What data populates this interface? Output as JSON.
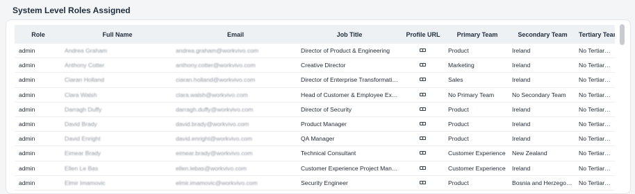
{
  "page": {
    "title": "System Level Roles Assigned"
  },
  "table": {
    "headers": [
      "Role",
      "Full Name",
      "Email",
      "Job Title",
      "Profile URL",
      "Primary Team",
      "Secondary Team",
      "Tertiary Team"
    ],
    "rows": [
      [
        "admin",
        "Andrea Graham",
        "andrea.graham@workvivo.com",
        "Director of Product & Engineering",
        "link-icon",
        "Product",
        "Ireland",
        "No Tertiary Team"
      ],
      [
        "admin",
        "Anthony Cotter",
        "anthony.cotter@workvivo.com",
        "Creative Director",
        "link-icon",
        "Marketing",
        "Ireland",
        "No Tertiary Team"
      ],
      [
        "admin",
        "Ciaran Holland",
        "ciaran.holland@workvivo.com",
        "Director of Enterprise Transformation",
        "link-icon",
        "Sales",
        "Ireland",
        "No Tertiary Team"
      ],
      [
        "admin",
        "Clara Walsh",
        "clara.walsh@workvivo.com",
        "Head of Customer & Employee Experience",
        "link-icon",
        "No Primary Team",
        "No Secondary Team",
        "No Tertiary Team"
      ],
      [
        "admin",
        "Darragh Duffy",
        "darragh.duffy@workvivo.com",
        "Director of Security",
        "link-icon",
        "Product",
        "Ireland",
        "No Tertiary Team"
      ],
      [
        "admin",
        "David Brady",
        "david.brady@workvivo.com",
        "Product Manager",
        "link-icon",
        "Product",
        "Ireland",
        "No Tertiary Team"
      ],
      [
        "admin",
        "David Enright",
        "david.enright@workvivo.com",
        "QA Manager",
        "link-icon",
        "Product",
        "Ireland",
        "No Tertiary Team"
      ],
      [
        "admin",
        "Eimear Brady",
        "eimear.brady@workvivo.com",
        "Technical Consultant",
        "link-icon",
        "Customer Experience",
        "New Zealand",
        "No Tertiary Team"
      ],
      [
        "admin",
        "Ellen Le Bas",
        "ellen.lebas@workvivo.com",
        "Customer Experience Project Manager",
        "link-icon",
        "Customer Experience",
        "Ireland",
        "No Tertiary Team"
      ],
      [
        "admin",
        "Elmir Imamovic",
        "elmir.imamovic@workvivo.com",
        "Security Engineer",
        "link-icon",
        "Product",
        "Bosnia and Herzegovina",
        "No Tertiary Team"
      ]
    ]
  }
}
